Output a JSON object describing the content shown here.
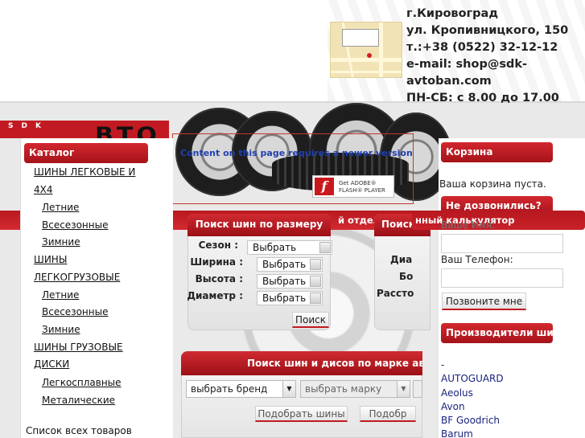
{
  "header": {
    "city": "г.Кировоград",
    "street": "ул. Кропивницкого, 150",
    "phone": "т.:+38 (0522) 32-12-12",
    "email_line1": "e-mail: shop@sdk-",
    "email_line2": "avtoban.com",
    "hours": "ПН-СБ: с 8.00 до 17.00",
    "logo_small": "SDK",
    "logo_big": "BTO"
  },
  "flash": {
    "message": "Content on this page requires a newer version",
    "badge_line1": "Get ADOBE®",
    "badge_line2": "FLASH® PLAYER"
  },
  "red_band": {
    "label": "й отдел"
  },
  "catalog": {
    "title": "Каталог",
    "items": [
      {
        "label": "ШИНЫ ЛЕГКОВЫЕ И"
      },
      {
        "label": "4Х4"
      },
      {
        "label": "Летние"
      },
      {
        "label": "Всесезонные"
      },
      {
        "label": "Зимние"
      },
      {
        "label": "ШИНЫ"
      },
      {
        "label": "ЛЕГКОГРУЗОВЫЕ"
      },
      {
        "label": "Летние"
      },
      {
        "label": "Всесезонные"
      },
      {
        "label": "Зимние"
      },
      {
        "label": "ШИНЫ ГРУЗОВЫЕ"
      },
      {
        "label": "ДИСКИ"
      },
      {
        "label": "Легкосплавные"
      },
      {
        "label": "Металические"
      },
      {
        "label": "Список всех товаров"
      }
    ]
  },
  "size_search": {
    "title": "Поиск шин по размеру",
    "season_label": "Сезон :",
    "width_label": "Ширина :",
    "height_label": "Высота :",
    "diameter_label": "Диаметр :",
    "season_value": "Выбрать",
    "width_value": "Выбрать",
    "height_value": "Выбрать",
    "diameter_value": "Выбрать",
    "button": "Поиск"
  },
  "disc_search": {
    "title": "Поиск",
    "label1": "Диа",
    "label2": "Бо",
    "label3": "Рассто"
  },
  "brand_search": {
    "title": "Поиск шин и дисов по марке ав",
    "brand_select": "выбрать бренд",
    "model_select": "выбрать марку",
    "btn_tires": "Подобрать шины",
    "btn_discs": "Подобр"
  },
  "cart": {
    "title": "Корзина",
    "empty_text": "Ваша корзина пуста."
  },
  "callback": {
    "title": "Не дозвонились?",
    "calc_label": "нный калькулятор",
    "name_label": "Ваше Имя:",
    "phone_label": "Ваш Телефон:",
    "button": "Позвоните мне"
  },
  "manufacturers": {
    "title": "Производители шин",
    "items": [
      "-",
      "AUTOGUARD",
      "Aeolus",
      "Avon",
      "BF Goodrich",
      "Barum"
    ]
  }
}
